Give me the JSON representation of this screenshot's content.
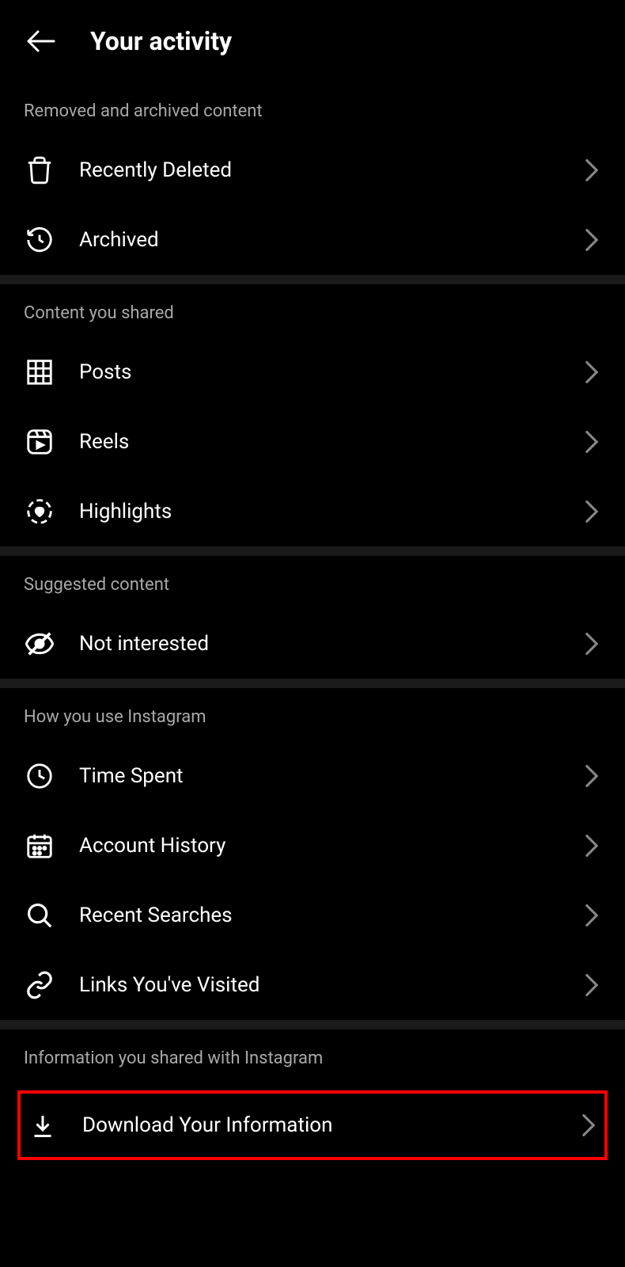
{
  "header": {
    "title": "Your activity"
  },
  "sections": [
    {
      "title": "Removed and archived content",
      "items": [
        {
          "icon": "trash-icon",
          "label": "Recently Deleted"
        },
        {
          "icon": "history-icon",
          "label": "Archived"
        }
      ]
    },
    {
      "title": "Content you shared",
      "items": [
        {
          "icon": "grid-icon",
          "label": "Posts"
        },
        {
          "icon": "reels-icon",
          "label": "Reels"
        },
        {
          "icon": "highlights-icon",
          "label": "Highlights"
        }
      ]
    },
    {
      "title": "Suggested content",
      "items": [
        {
          "icon": "eye-off-icon",
          "label": "Not interested"
        }
      ]
    },
    {
      "title": "How you use Instagram",
      "items": [
        {
          "icon": "clock-icon",
          "label": "Time Spent"
        },
        {
          "icon": "calendar-icon",
          "label": "Account History"
        },
        {
          "icon": "search-icon",
          "label": "Recent Searches"
        },
        {
          "icon": "link-icon",
          "label": "Links You've Visited"
        }
      ]
    },
    {
      "title": "Information you shared with Instagram",
      "items": [
        {
          "icon": "download-icon",
          "label": "Download Your Information",
          "highlighted": true
        }
      ]
    }
  ]
}
